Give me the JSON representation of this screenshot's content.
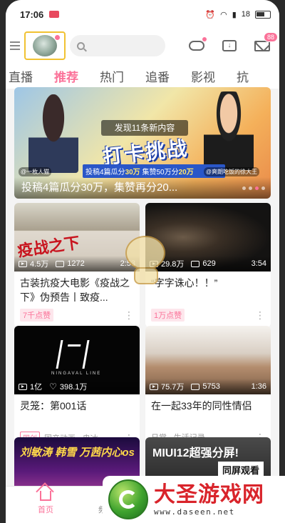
{
  "status_bar": {
    "time": "17:06",
    "battery": "18"
  },
  "header": {
    "search_placeholder": "",
    "message_badge": "88"
  },
  "tabs": [
    {
      "label": "直播"
    },
    {
      "label": "推荐"
    },
    {
      "label": "热门"
    },
    {
      "label": "追番"
    },
    {
      "label": "影视"
    },
    {
      "label": "抗"
    }
  ],
  "banner": {
    "notice": "发现11条新内容",
    "big_text": "打卡挑战",
    "sub_prefix": "投稿4篇瓜分",
    "sub_amount1": "30万",
    "sub_middle": " 集赞50万分",
    "sub_amount2": "20万",
    "tag_left": "@一枚人猫",
    "tag_right": "@爽朗吃饭的徐大王",
    "caption": "投稿4篇瓜分30万，集赞再分20..."
  },
  "cards": [
    {
      "views": "4.5万",
      "danmaku": "1272",
      "duration": "2:53",
      "title": "古装抗疫大电影《疫战之下》伪预告丨致疫...",
      "badge": "7千点赞",
      "thumb_text": "疫战之下"
    },
    {
      "views": "29.8万",
      "danmaku": "629",
      "duration": "3:54",
      "title": "“字字诛心！！”",
      "badge": "1万点赞"
    },
    {
      "views": "1亿",
      "likes": "398.1万",
      "title": "灵笼：第001话",
      "tag": "国创",
      "meta": "国产动画 · 冉冰",
      "thumb_text": "NINGAVAL LINE"
    },
    {
      "views": "75.7万",
      "danmaku": "5753",
      "duration": "1:36",
      "title": "在一起33年的同性情侣",
      "meta": "日常 · 生活记录"
    },
    {
      "thumb_text": "刘敏涛 韩雪 万茜内心os"
    },
    {
      "thumb_text": "MIUI12超强分屏!",
      "thumb_box": "同屏观看"
    }
  ],
  "bottom_nav": {
    "home": "首页",
    "second": "频"
  },
  "watermark": {
    "name": "大圣游戏网",
    "url": "www.daseen.net"
  },
  "colors": {
    "accent": "#fb7299"
  }
}
